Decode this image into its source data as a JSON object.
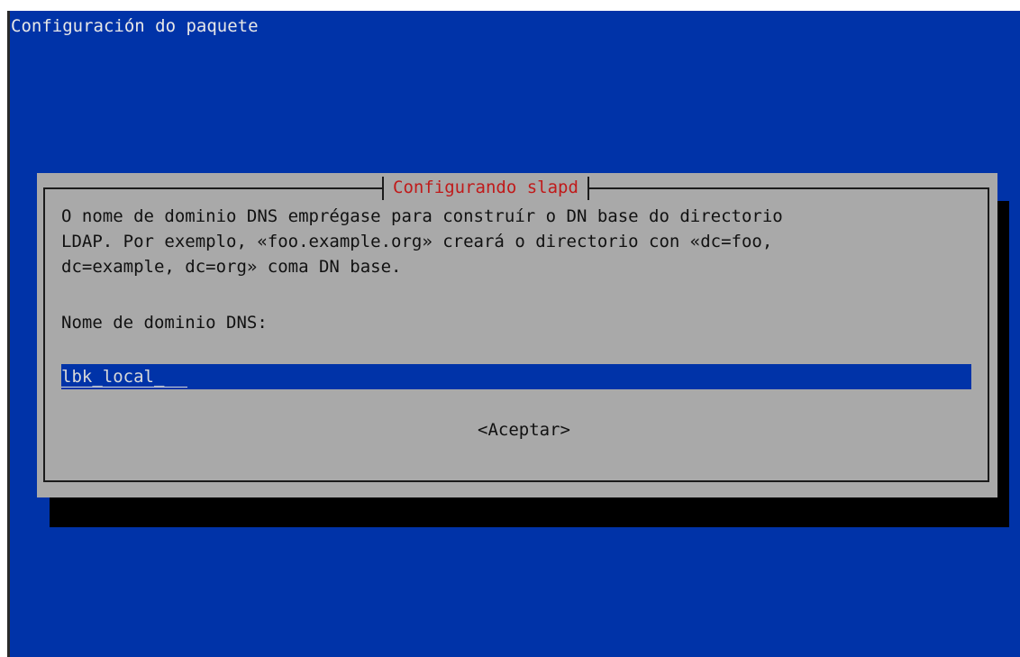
{
  "screen": {
    "title": "Configuración do paquete"
  },
  "dialog": {
    "title": "Configurando slapd",
    "message_lines": [
      "O nome de dominio DNS emprégase para construír o DN base do directorio",
      "LDAP. Por exemplo, «foo.example.org» creará o directorio con «dc=foo,",
      "dc=example, dc=org» coma DN base."
    ],
    "field_label": "Nome de dominio DNS:",
    "input_value": "lbk_local_",
    "ok_label": "<Aceptar>"
  },
  "colors": {
    "background": "#0033a8",
    "dialog": "#a9a9a9",
    "title": "#c01a1a",
    "input": "#0033a8"
  }
}
